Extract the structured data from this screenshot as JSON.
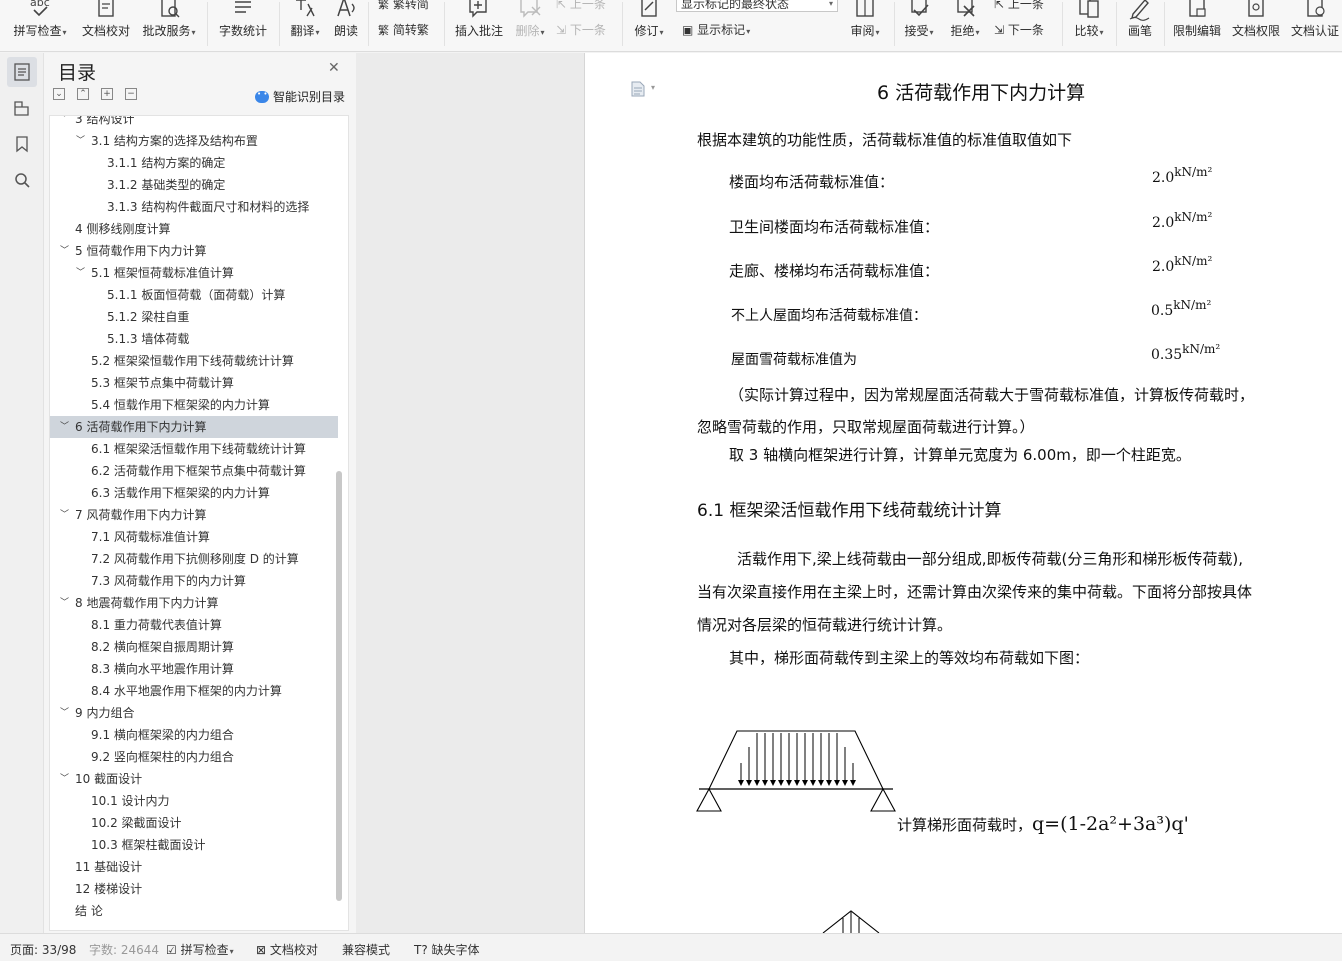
{
  "ribbon": {
    "buttons": [
      {
        "label": "拼写检查",
        "icon": "spell-check-icon",
        "dropdown": true
      },
      {
        "label": "文档校对",
        "icon": "doc-proofread-icon",
        "dropdown": false
      },
      {
        "label": "批改服务",
        "icon": "correction-service-icon",
        "dropdown": true
      },
      {
        "label": "字数统计",
        "icon": "word-count-icon",
        "dropdown": false
      },
      {
        "label": "翻译",
        "icon": "translate-icon",
        "dropdown": true
      },
      {
        "label": "朗读",
        "icon": "read-aloud-icon",
        "dropdown": false
      },
      {
        "label": "插入批注",
        "icon": "insert-comment-icon",
        "dropdown": false
      },
      {
        "label": "删除",
        "icon": "delete-comment-icon",
        "dropdown": true
      },
      {
        "label": "修订",
        "icon": "track-changes-icon",
        "dropdown": true
      },
      {
        "label": "审阅",
        "icon": "review-pane-icon",
        "dropdown": true
      },
      {
        "label": "接受",
        "icon": "accept-icon",
        "dropdown": true
      },
      {
        "label": "拒绝",
        "icon": "reject-icon",
        "dropdown": true
      },
      {
        "label": "比较",
        "icon": "compare-icon",
        "dropdown": true
      },
      {
        "label": "画笔",
        "icon": "pen-icon",
        "dropdown": false
      },
      {
        "label": "限制编辑",
        "icon": "restrict-edit-icon",
        "dropdown": false
      },
      {
        "label": "文档权限",
        "icon": "doc-permission-icon",
        "dropdown": false
      },
      {
        "label": "文档认证",
        "icon": "doc-certify-icon",
        "dropdown": false
      }
    ],
    "fanjianzhuan": "繁转简",
    "jianzhuanfan": "简转繁",
    "prev_comment": "上一条",
    "next_comment": "下一条",
    "markup_state": "显示标记的最终状态",
    "show_markup": "显示标记",
    "prev_change": "上一条",
    "next_change": "下一条"
  },
  "toc": {
    "title": "目录",
    "ai_label": "智能识别目录",
    "items": [
      {
        "text": "3  结构设计",
        "level": 1,
        "expand": true
      },
      {
        "text": "3.1  结构方案的选择及结构布置",
        "level": 2,
        "expand": true
      },
      {
        "text": "3.1.1  结构方案的确定",
        "level": 3
      },
      {
        "text": "3.1.2  基础类型的确定",
        "level": 3
      },
      {
        "text": "3.1.3  结构构件截面尺寸和材料的选择",
        "level": 3
      },
      {
        "text": "4  侧移线刚度计算",
        "level": 1
      },
      {
        "text": "5  恒荷载作用下内力计算",
        "level": 1,
        "expand": true
      },
      {
        "text": "5.1  框架恒荷载标准值计算",
        "level": 2,
        "expand": true
      },
      {
        "text": "5.1.1  板面恒荷载（面荷载）计算",
        "level": 3
      },
      {
        "text": "5.1.2  梁柱自重",
        "level": 3
      },
      {
        "text": "5.1.3  墙体荷载",
        "level": 3
      },
      {
        "text": "5.2  框架梁恒载作用下线荷载统计计算",
        "level": 2
      },
      {
        "text": "5.3  框架节点集中荷载计算",
        "level": 2
      },
      {
        "text": "5.4  恒载作用下框架梁的内力计算",
        "level": 2
      },
      {
        "text": "6  活荷载作用下内力计算",
        "level": 1,
        "expand": true,
        "selected": true
      },
      {
        "text": "6.1  框架梁活恒载作用下线荷载统计计算",
        "level": 2
      },
      {
        "text": "6.2  活荷载作用下框架节点集中荷载计算",
        "level": 2
      },
      {
        "text": "6.3  活载作用下框架梁的内力计算",
        "level": 2
      },
      {
        "text": "7  风荷载作用下内力计算",
        "level": 1,
        "expand": true
      },
      {
        "text": "7.1  风荷载标准值计算",
        "level": 2
      },
      {
        "text": "7.2  风荷载作用下抗侧移刚度 D 的计算",
        "level": 2
      },
      {
        "text": "7.3  风荷载作用下的内力计算",
        "level": 2
      },
      {
        "text": "8  地震荷载作用下内力计算",
        "level": 1,
        "expand": true
      },
      {
        "text": "8.1  重力荷载代表值计算",
        "level": 2
      },
      {
        "text": "8.2  横向框架自振周期计算",
        "level": 2
      },
      {
        "text": "8.3  横向水平地震作用计算",
        "level": 2
      },
      {
        "text": "8.4  水平地震作用下框架的内力计算",
        "level": 2
      },
      {
        "text": "9  内力组合",
        "level": 1,
        "expand": true
      },
      {
        "text": "9.1  横向框架梁的内力组合",
        "level": 2
      },
      {
        "text": "9.2  竖向框架柱的内力组合",
        "level": 2
      },
      {
        "text": "10  截面设计",
        "level": 1,
        "expand": true
      },
      {
        "text": "10.1  设计内力",
        "level": 2
      },
      {
        "text": "10.2  梁截面设计",
        "level": 2
      },
      {
        "text": "10.3  框架柱截面设计",
        "level": 2
      },
      {
        "text": "11  基础设计",
        "level": 1
      },
      {
        "text": "12  楼梯设计",
        "level": 1
      },
      {
        "text": "结    论",
        "level": 1
      }
    ]
  },
  "document": {
    "heading": "6  活荷载作用下内力计算",
    "intro": "根据本建筑的功能性质，活荷载标准值的标准值取值如下",
    "loads": [
      {
        "label": "楼面均布活荷载标准值：",
        "value": "2.0",
        "unit": "kN/m²"
      },
      {
        "label": "卫生间楼面均布活荷载标准值：",
        "value": "2.0",
        "unit": "kN/m²"
      },
      {
        "label": "走廊、楼梯均布活荷载标准值：",
        "value": "2.0",
        "unit": "kN/m²"
      },
      {
        "label": "不上人屋面均布活荷载标准值：",
        "value": "0.5",
        "unit": "kN/m²"
      },
      {
        "label": "屋面雪荷载标准值为",
        "value": "0.35",
        "unit": "kN/m²"
      }
    ],
    "note_line1": "（实际计算过程中，因为常规屋面活荷载大于雪荷载标准值，计算板传荷载时，",
    "note_line2": "忽略雪荷载的作用，只取常规屋面荷载进行计算。）",
    "frame_line": "取 3 轴横向框架进行计算，计算单元宽度为 6.00m，即一个柱距宽。",
    "section_heading": "6.1  框架梁活恒载作用下线荷载统计计算",
    "para1_line1": "活载作用下,梁上线荷载由一部分组成,即板传荷载(分三角形和梯形板传荷载),",
    "para1_line2": "当有次梁直接作用在主梁上时，还需计算由次梁传来的集中荷载。下面将分部按具体",
    "para1_line3": "情况对各层梁的恒荷载进行统计计算。",
    "para2": "其中，梯形面荷载传到主梁上的等效均布荷载如下图：",
    "formula_prefix": "计算梯形面荷载时，",
    "formula": "q=(1-2a²+3a³)q'"
  },
  "status": {
    "page": "页面: 33/98",
    "words": "字数: 24644",
    "spell": "拼写检查",
    "proofread": "文档校对",
    "compat": "兼容模式",
    "missing_font": "缺失字体"
  }
}
